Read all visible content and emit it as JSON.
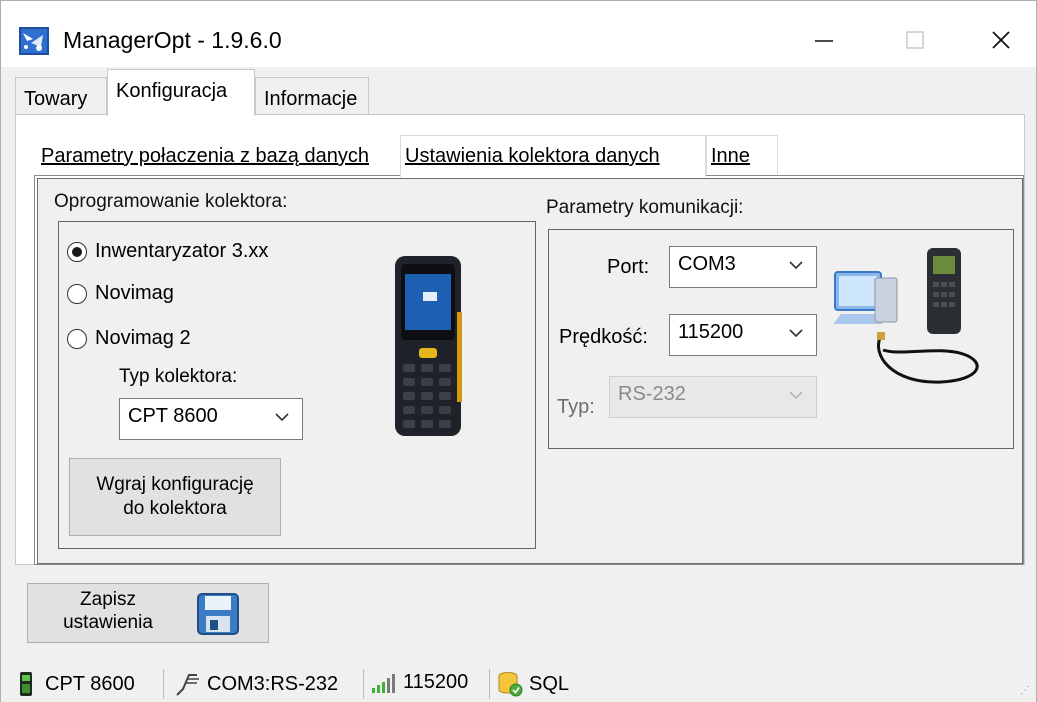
{
  "window": {
    "title": "ManagerOpt - 1.9.6.0",
    "controls": {
      "minimize": "—",
      "maximize": "☐",
      "close": "✕"
    }
  },
  "main_tabs": [
    {
      "label": "Towary",
      "active": false
    },
    {
      "label": "Konfiguracja",
      "active": true
    },
    {
      "label": "Informacje",
      "active": false
    }
  ],
  "sub_tabs": [
    {
      "label": "Parametry połaczenia z bazą danych",
      "active": false
    },
    {
      "label": "Ustawienia kolektora danych",
      "active": true
    },
    {
      "label": "Inne",
      "active": false
    }
  ],
  "software_group": {
    "title": "Oprogramowanie kolektora:",
    "options": [
      {
        "label": "Inwentaryzator 3.xx",
        "checked": true
      },
      {
        "label": "Novimag",
        "checked": false
      },
      {
        "label": "Novimag 2",
        "checked": false
      }
    ],
    "collector_type_label": "Typ kolektora:",
    "collector_type_value": "CPT 8600",
    "upload_button": {
      "line1": "Wgraj konfigurację",
      "line2": "do kolektora"
    },
    "device_icon": "handheld-scanner-image"
  },
  "comm_group": {
    "title": "Parametry komunikacji:",
    "port_label": "Port:",
    "port_value": "COM3",
    "speed_label": "Prędkość:",
    "speed_value": "115200",
    "type_label": "Typ:",
    "type_value": "RS-232",
    "type_disabled": true,
    "illustration": "computer-cable-scanner-image"
  },
  "save_button": {
    "line1": "Zapisz",
    "line2": "ustawienia",
    "icon": "floppy-disk-icon"
  },
  "status_bar": {
    "device": "CPT 8600",
    "connection": "COM3:RS-232",
    "speed": "115200",
    "db": "SQL"
  },
  "colors": {
    "accent": "#1a63b8",
    "panel": "#f0f0f0",
    "border": "#646464"
  }
}
